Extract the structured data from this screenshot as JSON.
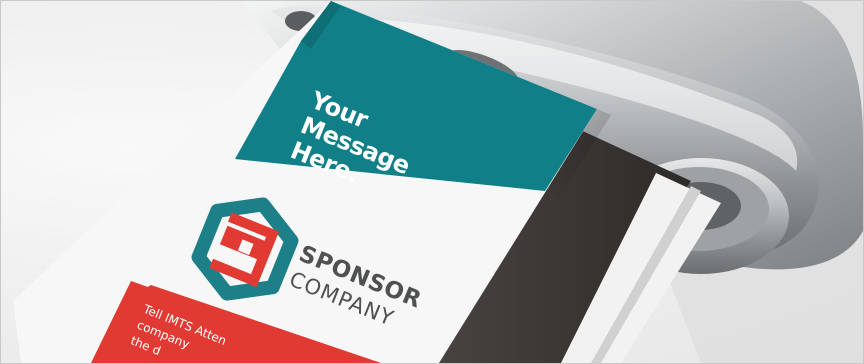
{
  "card": {
    "headline": [
      "Your",
      "Message",
      "Here."
    ],
    "brand_name": "SPONSOR",
    "brand_sub": "COMPANY",
    "footer_lines": [
      "Tell IMTS Atten",
      "company",
      "the d"
    ]
  },
  "colors": {
    "teal": "#117f88",
    "red": "#e03a33",
    "logo_teal": "#1d7f88",
    "text_gray": "#4f5151",
    "steel": "#b9bcbe"
  },
  "icons": {
    "logo": "interlocking-s-hexagon-logo"
  }
}
